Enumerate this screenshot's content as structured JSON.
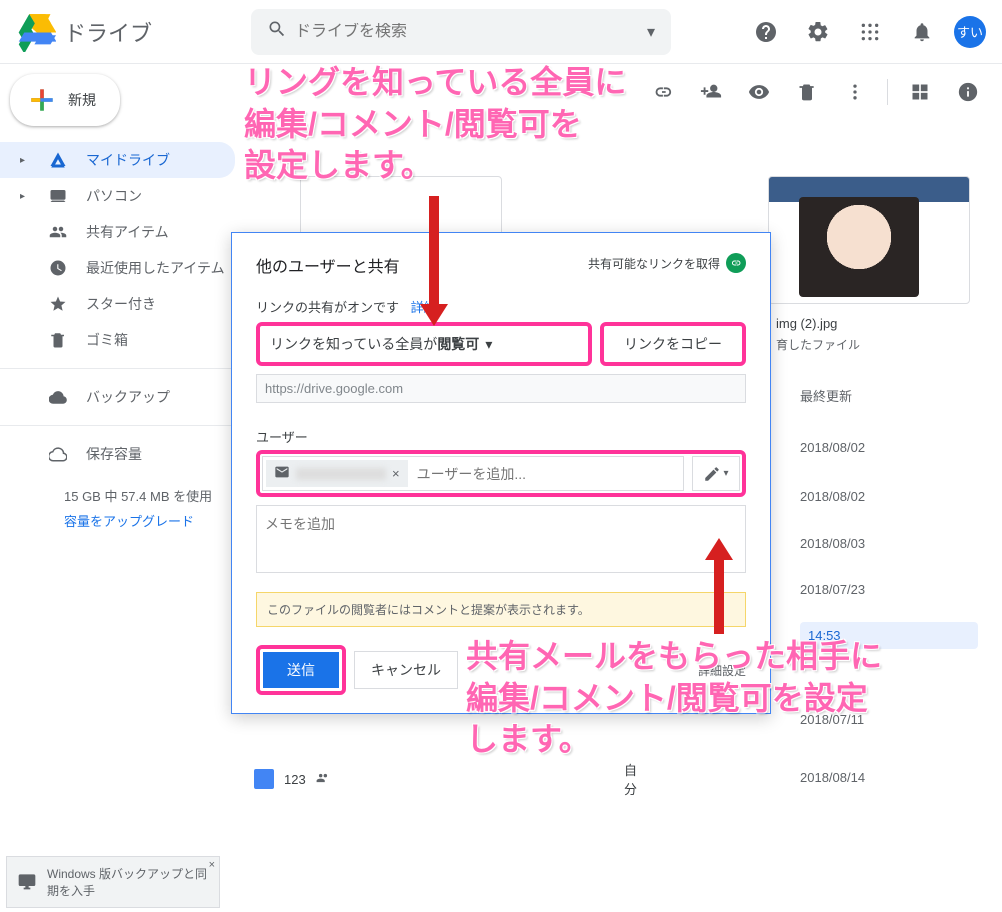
{
  "header": {
    "app_name": "ドライブ",
    "search_placeholder": "ドライブを検索",
    "avatar_text": "すい"
  },
  "sidebar": {
    "new_label": "新規",
    "items": [
      {
        "label": "マイドライブ"
      },
      {
        "label": "パソコン"
      },
      {
        "label": "共有アイテム"
      },
      {
        "label": "最近使用したアイテム"
      },
      {
        "label": "スター付き"
      },
      {
        "label": "ゴミ箱"
      },
      {
        "label": "バックアップ"
      },
      {
        "label": "保存容量"
      }
    ],
    "storage_text": "15 GB 中 57.4 MB を使用",
    "upgrade_text": "容量をアップグレード"
  },
  "thumb": {
    "filename": "img (2).jpg",
    "subtitle": "育したファイル"
  },
  "table": {
    "last_modified_header": "最終更新",
    "dates": [
      "2018/08/02",
      "2018/08/02",
      "2018/08/03",
      "2018/07/23",
      "14:53",
      "2018/07/11",
      "2018/08/14"
    ],
    "last_row_name": "123",
    "last_row_owner": "自分"
  },
  "dialog": {
    "title": "他のユーザーと共有",
    "get_link_label": "共有可能なリンクを取得",
    "link_status_text": "リンクの共有がオンです",
    "link_details": "詳細",
    "perm_prefix": "リンクを知っている全員が",
    "perm_bold": "閲覧可",
    "copy_link": "リンクをコピー",
    "url_value": "https://drive.google.com",
    "users_label": "ユーザー",
    "add_user_placeholder": "ユーザーを追加...",
    "memo_placeholder": "メモを追加",
    "yellow_notice": "このファイルの閲覧者にはコメントと提案が表示されます。",
    "send": "送信",
    "cancel": "キャンセル",
    "advanced": "詳細設定"
  },
  "annotations": {
    "top": "リングを知っている全員に\n編集/コメント/閲覧可を\n設定します。",
    "bottom": "共有メールをもらった相手に\n編集/コメント/閲覧可を設定\nします。"
  },
  "bottom_strip": {
    "text": "Windows 版バックアップと同期を入手"
  }
}
